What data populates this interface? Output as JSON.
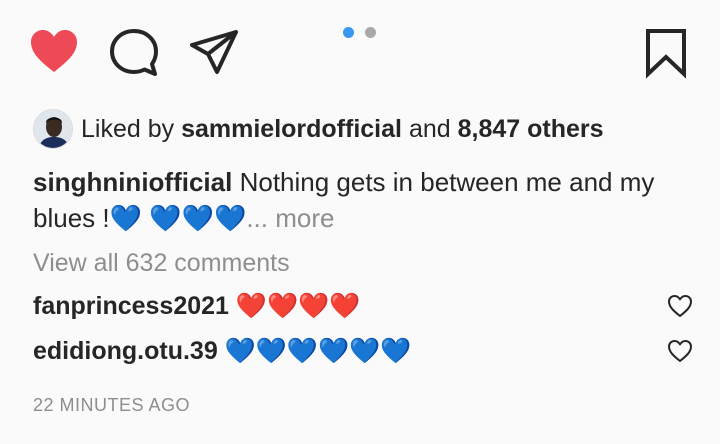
{
  "post": {
    "liked": true,
    "carousel": {
      "count": 2,
      "active_index": 0,
      "active_color": "#3897f0",
      "inactive_color": "#a8a8a8"
    },
    "icons": {
      "like": "heart-filled-icon",
      "comment": "comment-bubble-icon",
      "share": "paper-plane-icon",
      "save": "bookmark-icon"
    },
    "colors": {
      "like_red": "#ed4956",
      "text": "#262626",
      "muted": "#8e8e8e"
    }
  },
  "likes": {
    "prefix": "Liked by",
    "user": "sammielordofficial",
    "conjunction": "and",
    "others": "8,847 others"
  },
  "caption": {
    "username": "singhniniofficial",
    "text": "Nothing gets in between me and my blues !💙 💙💙💙",
    "more": "... more"
  },
  "view_all_comments": "View all 632 comments",
  "comments": [
    {
      "username": "fanprincess2021",
      "text": "❤️❤️❤️❤️"
    },
    {
      "username": "edidiong.otu.39",
      "text": "💙💙💙💙💙💙"
    }
  ],
  "timestamp": "22 MINUTES AGO"
}
